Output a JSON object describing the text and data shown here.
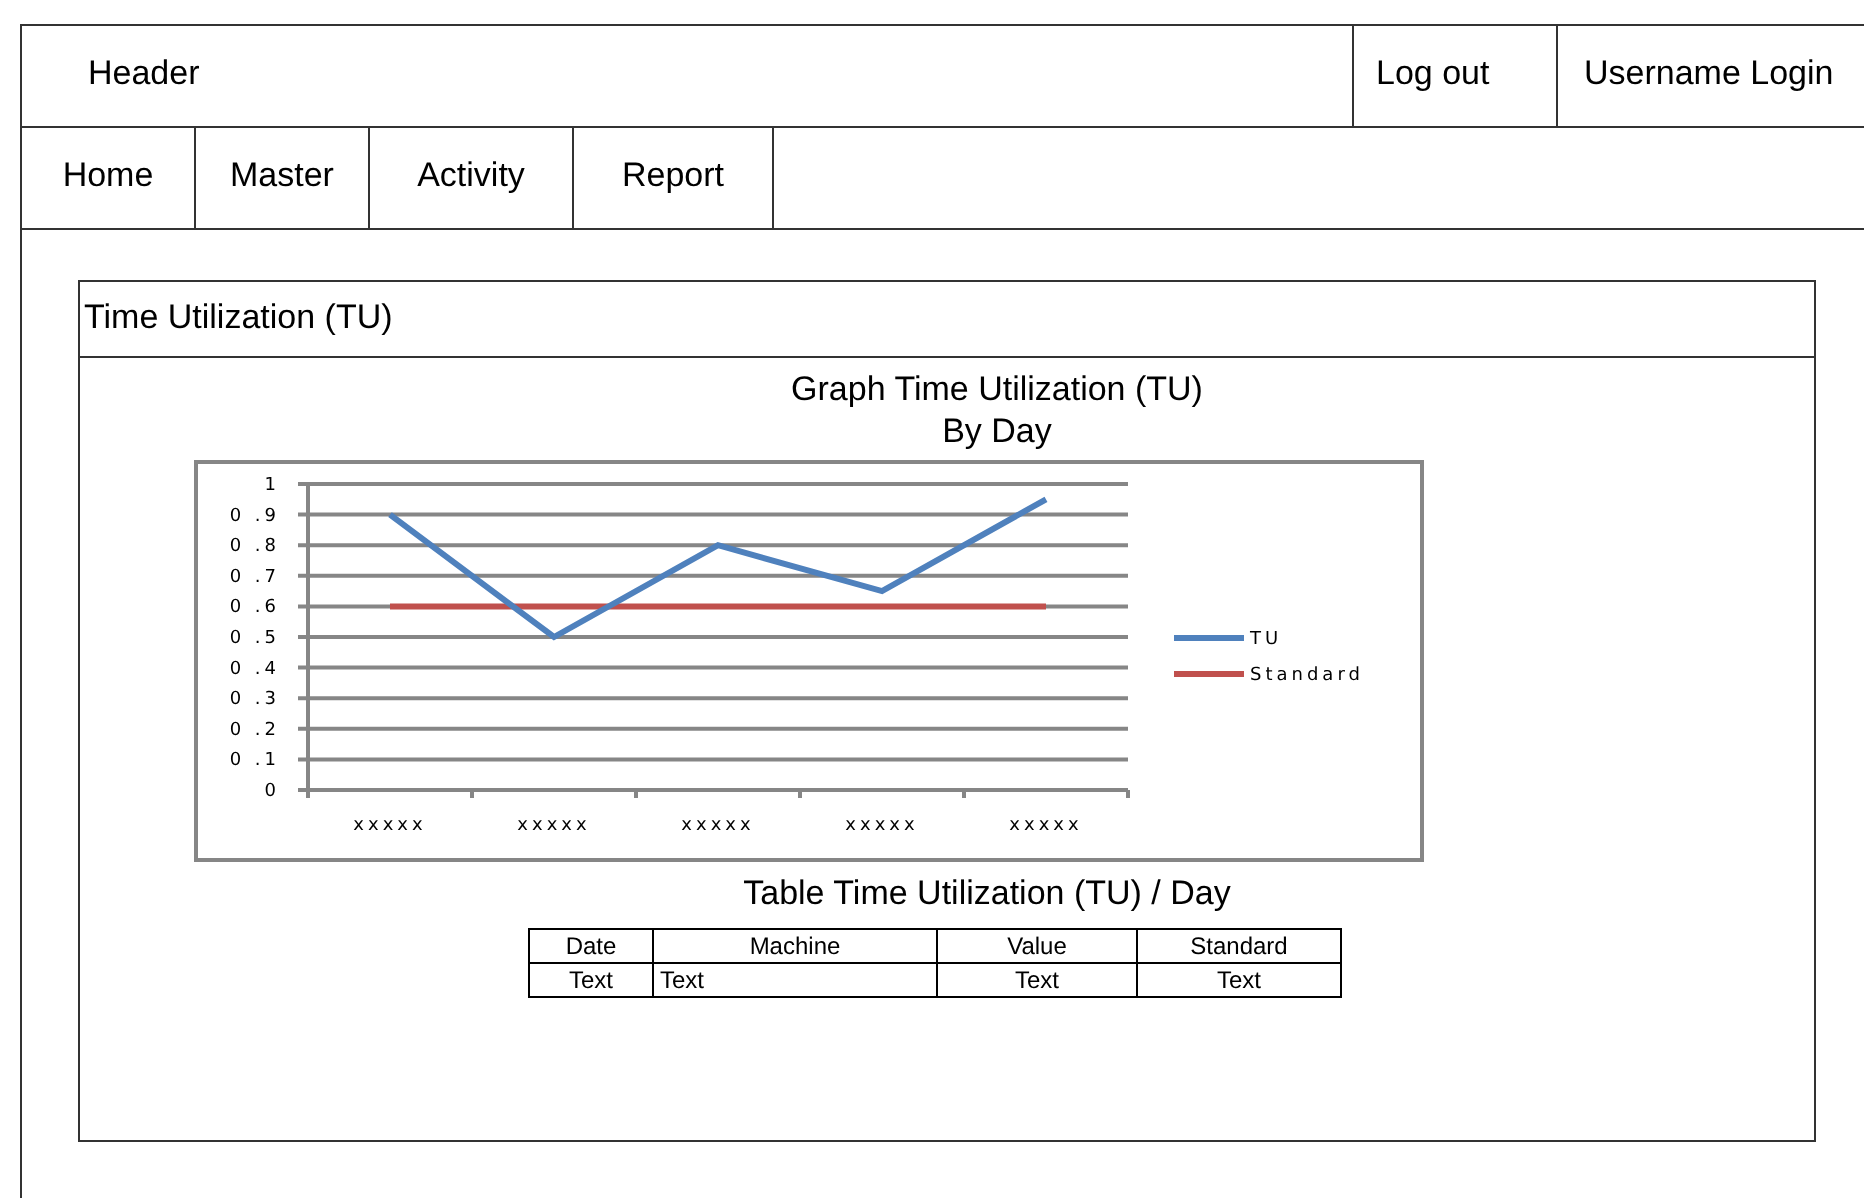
{
  "header": {
    "title": "Header",
    "actions": [
      "Log out",
      "Username Login"
    ]
  },
  "nav": {
    "items": [
      {
        "label": "Home"
      },
      {
        "label": "Master"
      },
      {
        "label": "Activity"
      },
      {
        "label": "Report"
      }
    ]
  },
  "panel": {
    "title": "Time Utilization (TU)",
    "graph_heading": [
      "Graph Time Utilization (TU)",
      "By Day"
    ],
    "chart_data": {
      "type": "line",
      "categories": [
        "xxxxx",
        "xxxxx",
        "xxxxx",
        "xxxxx",
        "xxxxx"
      ],
      "series": [
        {
          "name": "TU",
          "color": "#4f81bd",
          "values": [
            0.9,
            0.5,
            0.8,
            0.65,
            0.95
          ]
        },
        {
          "name": "Standard",
          "color": "#c0504d",
          "values": [
            0.6,
            0.6,
            0.6,
            0.6,
            0.6
          ]
        }
      ],
      "grid": true,
      "legend": true,
      "ylim": [
        0,
        1
      ],
      "yticks": [
        0,
        {
          "value": 0.1,
          "label": "0 .1"
        },
        {
          "value": 0.2,
          "label": "0 .2"
        },
        {
          "value": 0.3,
          "label": "0 .3"
        },
        {
          "value": 0.4,
          "label": "0 .4"
        },
        {
          "value": 0.5,
          "label": "0 .5"
        },
        {
          "value": 0.6,
          "label": "0 .6"
        },
        {
          "value": 0.7,
          "label": "0 .7"
        },
        {
          "value": 0.8,
          "label": "0 .8"
        },
        {
          "value": 0.9,
          "label": "0 .9"
        },
        1
      ]
    },
    "table_heading": "Table Time Utilization (TU) / Day",
    "table": {
      "columns": [
        "Date",
        "Machine",
        "Value",
        "Standard"
      ],
      "rows": [
        [
          "Text",
          "Text",
          "Text",
          "Text"
        ]
      ]
    }
  }
}
